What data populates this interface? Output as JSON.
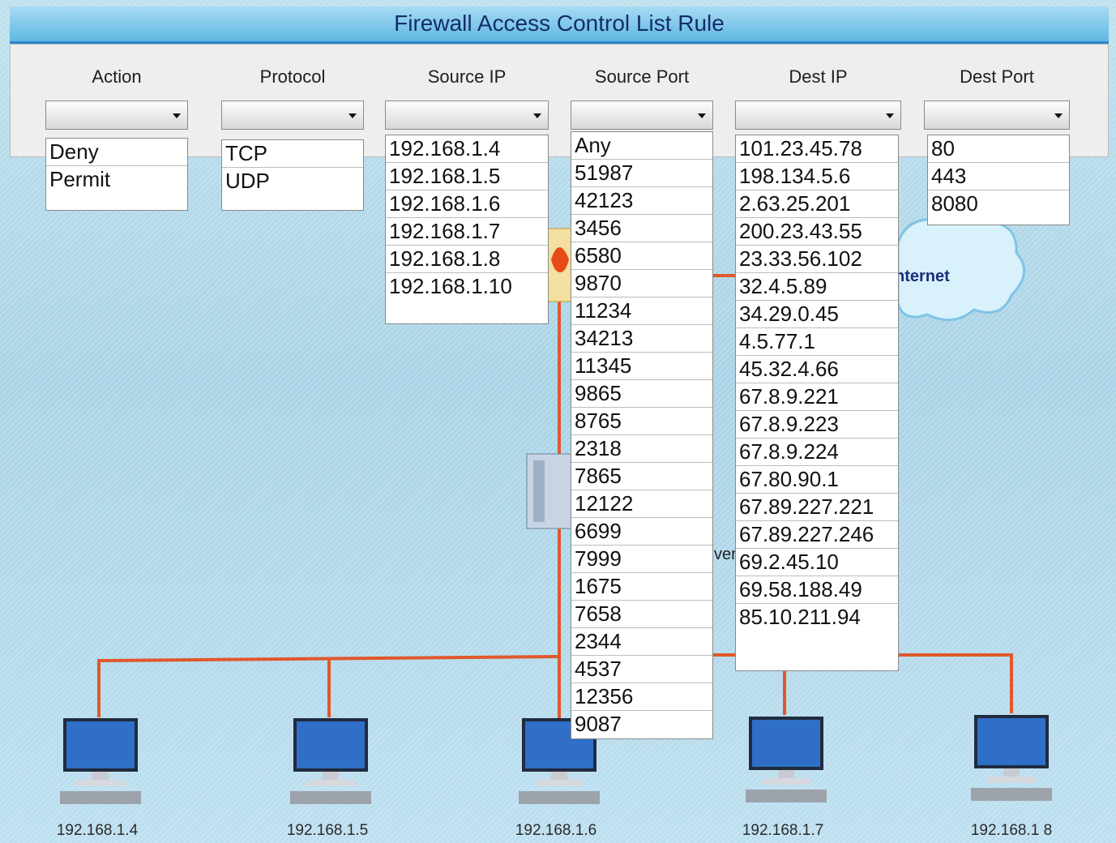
{
  "window": {
    "title": "Firewall Access Control List Rule"
  },
  "columns": [
    {
      "id": "action",
      "header": "Action",
      "options": [
        "Deny",
        "Permit"
      ]
    },
    {
      "id": "protocol",
      "header": "Protocol",
      "options": [
        "TCP",
        "UDP"
      ]
    },
    {
      "id": "source_ip",
      "header": "Source IP",
      "options": [
        "192.168.1.4",
        "192.168.1.5",
        "192.168.1.6",
        "192.168.1.7",
        "192.168.1.8",
        "192.168.1.10"
      ]
    },
    {
      "id": "source_port",
      "header": "Source Port",
      "options": [
        "Any",
        "51987",
        "42123",
        "3456",
        "6580",
        "9870",
        "11234",
        "34213",
        "11345",
        "9865",
        "8765",
        "2318",
        "7865",
        "12122",
        "6699",
        "7999",
        "1675",
        "7658",
        "2344",
        "4537",
        "12356",
        "9087"
      ]
    },
    {
      "id": "dest_ip",
      "header": "Dest IP",
      "options": [
        "101.23.45.78",
        "198.134.5.6",
        "2.63.25.201",
        "200.23.43.55",
        "23.33.56.102",
        "32.4.5.89",
        "34.29.0.45",
        "4.5.77.1",
        "45.32.4.66",
        "67.8.9.221",
        "67.8.9.223",
        "67.8.9.224",
        "67.80.90.1",
        "67.89.227.221",
        "67.89.227.246",
        "69.2.45.10",
        "69.58.188.49",
        "85.10.211.94"
      ]
    },
    {
      "id": "dest_port",
      "header": "Dest Port",
      "options": [
        "80",
        "443",
        "8080"
      ]
    }
  ],
  "dropdowns": {
    "action": {
      "selected": ""
    },
    "protocol": {
      "selected": ""
    },
    "source_ip": {
      "selected": ""
    },
    "source_port": {
      "selected": ""
    },
    "dest_ip": {
      "selected": ""
    },
    "dest_port": {
      "selected": ""
    }
  },
  "network": {
    "cloud_label": "nternet",
    "server_label_fragment": "ver",
    "computers": [
      "192.168.1.4",
      "192.168.1.5",
      "192.168.1.6",
      "192.168.1.7",
      "192.168.1 8"
    ]
  },
  "colors": {
    "title_text": "#142d6a",
    "title_bar": "#5fb7e3",
    "cable": "#e0582a",
    "panel": "#eeeeee"
  },
  "icons": {
    "dropdown_arrow": "chevron-down-icon",
    "computer": "desktop-computer-icon",
    "cloud": "cloud-icon",
    "server": "server-icon",
    "firewall": "firewall-icon"
  }
}
